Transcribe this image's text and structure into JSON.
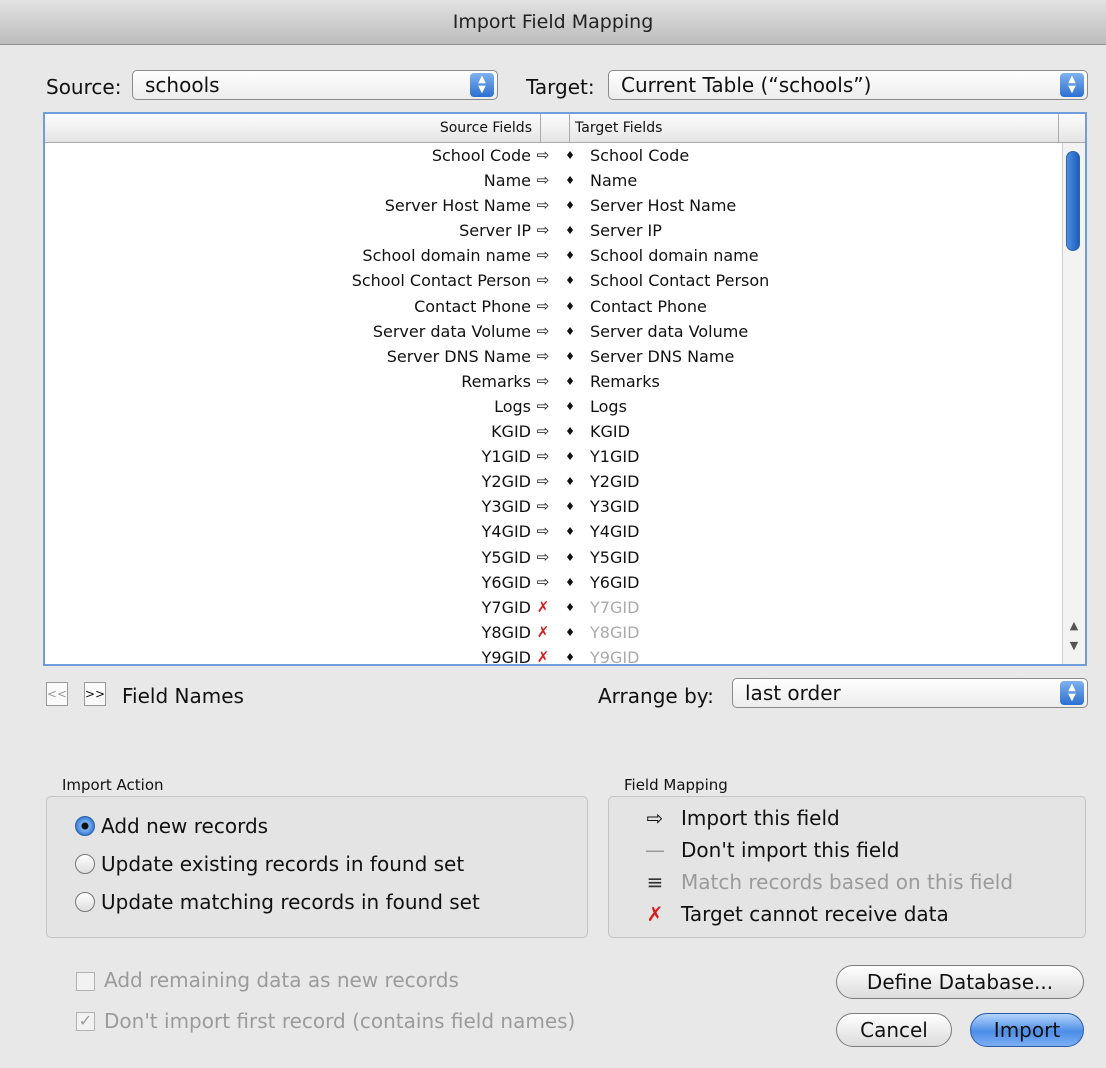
{
  "window": {
    "title": "Import Field Mapping"
  },
  "source": {
    "label": "Source:",
    "value": "schools"
  },
  "target": {
    "label": "Target:",
    "value": "Current Table (“schools”)"
  },
  "table": {
    "headers": {
      "source": "Source Fields",
      "target": "Target Fields"
    },
    "rows": [
      {
        "source": "School Code",
        "symbol": "⇨",
        "target": "School Code",
        "dim": false
      },
      {
        "source": "Name",
        "symbol": "⇨",
        "target": "Name",
        "dim": false
      },
      {
        "source": "Server Host Name",
        "symbol": "⇨",
        "target": "Server Host Name",
        "dim": false
      },
      {
        "source": "Server IP",
        "symbol": "⇨",
        "target": "Server IP",
        "dim": false
      },
      {
        "source": "School domain name",
        "symbol": "⇨",
        "target": "School domain name",
        "dim": false
      },
      {
        "source": "School Contact Person",
        "symbol": "⇨",
        "target": "School Contact Person",
        "dim": false
      },
      {
        "source": "Contact Phone",
        "symbol": "⇨",
        "target": "Contact Phone",
        "dim": false
      },
      {
        "source": "Server data Volume",
        "symbol": "⇨",
        "target": "Server data Volume",
        "dim": false
      },
      {
        "source": "Server DNS Name",
        "symbol": "⇨",
        "target": "Server DNS Name",
        "dim": false
      },
      {
        "source": "Remarks",
        "symbol": "⇨",
        "target": "Remarks",
        "dim": false
      },
      {
        "source": "Logs",
        "symbol": "⇨",
        "target": "Logs",
        "dim": false
      },
      {
        "source": "KGID",
        "symbol": "⇨",
        "target": "KGID",
        "dim": false
      },
      {
        "source": "Y1GID",
        "symbol": "⇨",
        "target": "Y1GID",
        "dim": false
      },
      {
        "source": "Y2GID",
        "symbol": "⇨",
        "target": "Y2GID",
        "dim": false
      },
      {
        "source": "Y3GID",
        "symbol": "⇨",
        "target": "Y3GID",
        "dim": false
      },
      {
        "source": "Y4GID",
        "symbol": "⇨",
        "target": "Y4GID",
        "dim": false
      },
      {
        "source": "Y5GID",
        "symbol": "⇨",
        "target": "Y5GID",
        "dim": false
      },
      {
        "source": "Y6GID",
        "symbol": "⇨",
        "target": "Y6GID",
        "dim": false
      },
      {
        "source": "Y7GID",
        "symbol": "✗",
        "target": "Y7GID",
        "dim": true
      },
      {
        "source": "Y8GID",
        "symbol": "✗",
        "target": "Y8GID",
        "dim": true
      },
      {
        "source": "Y9GID",
        "symbol": "✗",
        "target": "Y9GID",
        "dim": true
      }
    ]
  },
  "nav": {
    "prev": "<<",
    "next": ">>",
    "label": "Field Names"
  },
  "arrange": {
    "label": "Arrange by:",
    "value": "last order"
  },
  "import_action": {
    "title": "Import Action",
    "options": [
      {
        "label": "Add new records",
        "selected": true
      },
      {
        "label": "Update existing records in found set",
        "selected": false
      },
      {
        "label": "Update matching records in found set",
        "selected": false
      }
    ]
  },
  "field_mapping": {
    "title": "Field Mapping",
    "items": [
      {
        "icon": "⇨",
        "label": "Import this field",
        "dim": false
      },
      {
        "icon": "—",
        "label": "Don't import this field",
        "dim": false
      },
      {
        "icon": "≡",
        "label": "Match records based on this field",
        "dim": true
      },
      {
        "icon": "✗",
        "label": "Target cannot receive data",
        "dim": false
      }
    ]
  },
  "options": {
    "add_remaining": "Add remaining data as new records",
    "skip_first": "Don't import first record (contains field names)"
  },
  "buttons": {
    "define": "Define Database...",
    "cancel": "Cancel",
    "import": "Import"
  },
  "colors": {
    "accent": "#2c6fd0",
    "error": "#d42020"
  }
}
